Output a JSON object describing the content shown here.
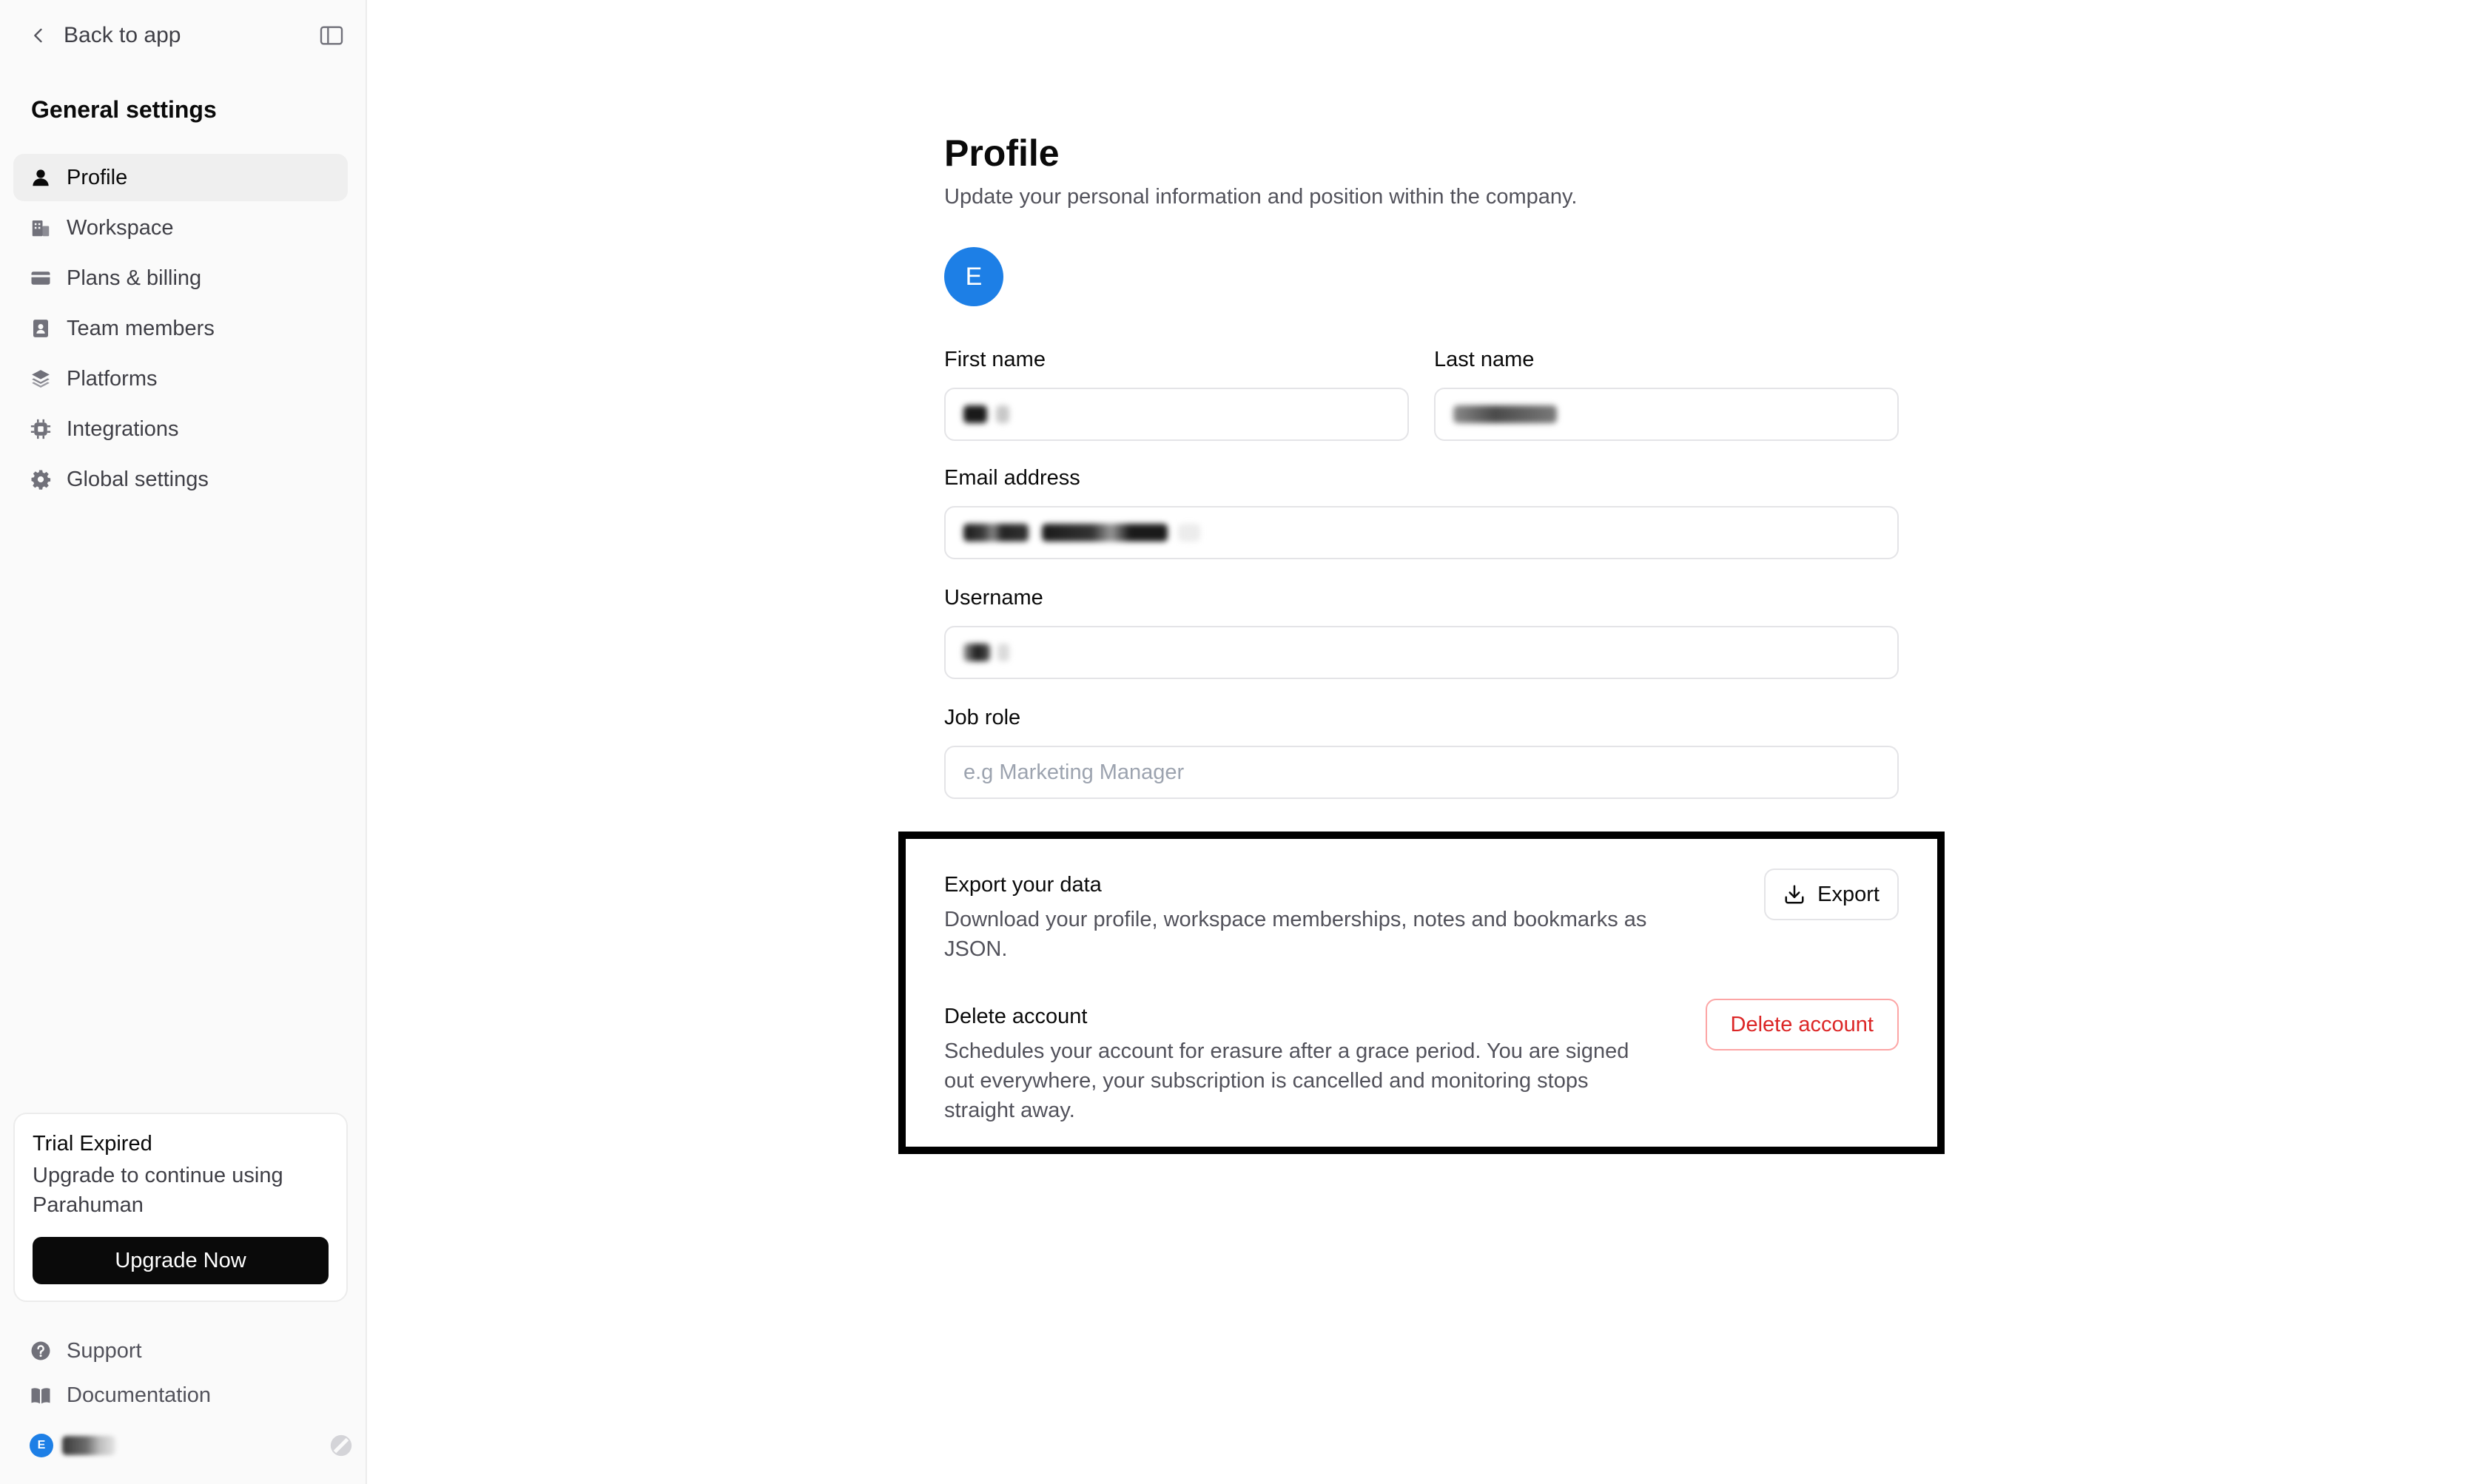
{
  "sidebar": {
    "back_label": "Back to app",
    "title": "General settings",
    "items": [
      {
        "label": "Profile",
        "icon": "user-icon",
        "active": true
      },
      {
        "label": "Workspace",
        "icon": "building-icon",
        "active": false
      },
      {
        "label": "Plans & billing",
        "icon": "credit-card-icon",
        "active": false
      },
      {
        "label": "Team members",
        "icon": "contact-book-icon",
        "active": false
      },
      {
        "label": "Platforms",
        "icon": "layers-icon",
        "active": false
      },
      {
        "label": "Integrations",
        "icon": "chip-icon",
        "active": false
      },
      {
        "label": "Global settings",
        "icon": "gear-icon",
        "active": false
      }
    ],
    "trial": {
      "title": "Trial Expired",
      "text": "Upgrade to continue using Parahuman",
      "button": "Upgrade Now"
    },
    "bottom_links": [
      {
        "label": "Support",
        "icon": "help-circle-icon"
      },
      {
        "label": "Documentation",
        "icon": "book-icon"
      }
    ],
    "user": {
      "avatar_letter": "E"
    }
  },
  "profile": {
    "title": "Profile",
    "subtitle": "Update your personal information and position within the company.",
    "avatar_letter": "E",
    "fields": {
      "first_name": {
        "label": "First name"
      },
      "last_name": {
        "label": "Last name"
      },
      "email": {
        "label": "Email address"
      },
      "username": {
        "label": "Username"
      },
      "job_role": {
        "label": "Job role",
        "placeholder": "e.g Marketing Manager"
      }
    }
  },
  "export": {
    "title": "Export your data",
    "description": "Download your profile, workspace memberships, notes and bookmarks as JSON.",
    "button": "Export"
  },
  "delete": {
    "title": "Delete account",
    "description": "Schedules your account for erasure after a grace period. You are signed out everywhere, your subscription is cancelled and monitoring stops straight away.",
    "button": "Delete account"
  },
  "colors": {
    "accent": "#1d7fe6",
    "danger": "#dc2626",
    "danger_border": "#fca5a5",
    "sidebar_bg": "#fafafa",
    "highlight_border": "#000000"
  }
}
